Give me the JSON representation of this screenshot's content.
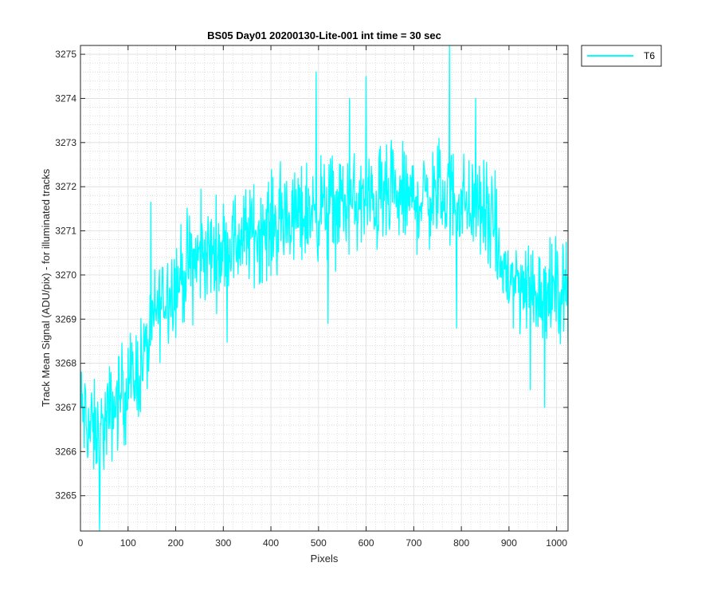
{
  "chart_data": {
    "type": "line",
    "title": "BS05 Day01 20200130-Lite-001 int time = 30 sec",
    "xlabel": "Pixels",
    "ylabel": "Track Mean Signal (ADU/pix) - for illuminated tracks",
    "xlim": [
      0,
      1024
    ],
    "ylim": [
      3264.2,
      3275.2
    ],
    "xticks": [
      0,
      100,
      200,
      300,
      400,
      500,
      600,
      700,
      800,
      900,
      1000
    ],
    "yticks": [
      3265,
      3266,
      3267,
      3268,
      3269,
      3270,
      3271,
      3272,
      3273,
      3274,
      3275
    ],
    "grid": "major and minor",
    "legend": "outside top-right",
    "series": [
      {
        "name": "T6",
        "color": "#00ffff",
        "x_start": 0,
        "x_step": 1,
        "trend": [
          [
            0,
            3267.0
          ],
          [
            20,
            3266.5
          ],
          [
            40,
            3266.3
          ],
          [
            60,
            3266.8
          ],
          [
            80,
            3267.2
          ],
          [
            100,
            3267.5
          ],
          [
            120,
            3267.8
          ],
          [
            140,
            3268.3
          ],
          [
            160,
            3269.2
          ],
          [
            180,
            3269.6
          ],
          [
            200,
            3269.8
          ],
          [
            220,
            3270.1
          ],
          [
            250,
            3270.4
          ],
          [
            300,
            3270.6
          ],
          [
            350,
            3270.9
          ],
          [
            400,
            3271.1
          ],
          [
            450,
            3271.3
          ],
          [
            500,
            3271.5
          ],
          [
            550,
            3271.6
          ],
          [
            600,
            3271.6
          ],
          [
            650,
            3271.7
          ],
          [
            700,
            3271.7
          ],
          [
            750,
            3271.8
          ],
          [
            800,
            3271.7
          ],
          [
            850,
            3271.4
          ],
          [
            870,
            3271.0
          ],
          [
            880,
            3270.3
          ],
          [
            900,
            3269.9
          ],
          [
            950,
            3269.7
          ],
          [
            1000,
            3269.6
          ],
          [
            1024,
            3269.8
          ]
        ],
        "noise_amplitude": 0.55,
        "spikes": [
          [
            40,
            3264.2
          ],
          [
            495,
            3274.6
          ],
          [
            520,
            3268.9
          ],
          [
            565,
            3274.0
          ],
          [
            600,
            3274.5
          ],
          [
            775,
            3275.2
          ],
          [
            790,
            3268.8
          ],
          [
            830,
            3274.0
          ],
          [
            945,
            3267.4
          ],
          [
            975,
            3267.0
          ]
        ]
      }
    ]
  }
}
